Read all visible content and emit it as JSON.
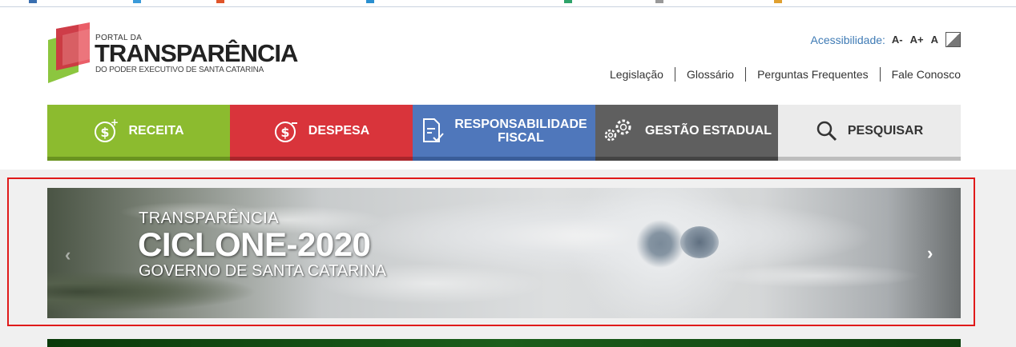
{
  "logo": {
    "line1": "PORTAL DA",
    "line2": "TRANSPARÊNCIA",
    "line3": "DO PODER EXECUTIVO DE SANTA CATARINA"
  },
  "accessibility": {
    "label": "Acessibilidade:",
    "decrease": "A-",
    "increase": "A+",
    "reset": "A"
  },
  "top_links": [
    "Legislação",
    "Glossário",
    "Perguntas Frequentes",
    "Fale Conosco"
  ],
  "menu": {
    "receita": "RECEITA",
    "despesa": "DESPESA",
    "resp_line1": "RESPONSABILIDADE",
    "resp_line2": "FISCAL",
    "gestao": "GESTÃO ESTADUAL",
    "pesquisar": "PESQUISAR"
  },
  "banner": {
    "line1": "TRANSPARÊNCIA",
    "line2": "CICLONE-2020",
    "line3": "GOVERNO DE SANTA CATARINA"
  },
  "colors": {
    "receita": "#8cbb2f",
    "despesa": "#d9343b",
    "responsabilidade": "#4f77bb",
    "gestao": "#5f5f5f",
    "pesquisar": "#ebebeb",
    "highlight": "#e01a1a",
    "link": "#3f7bb5"
  }
}
